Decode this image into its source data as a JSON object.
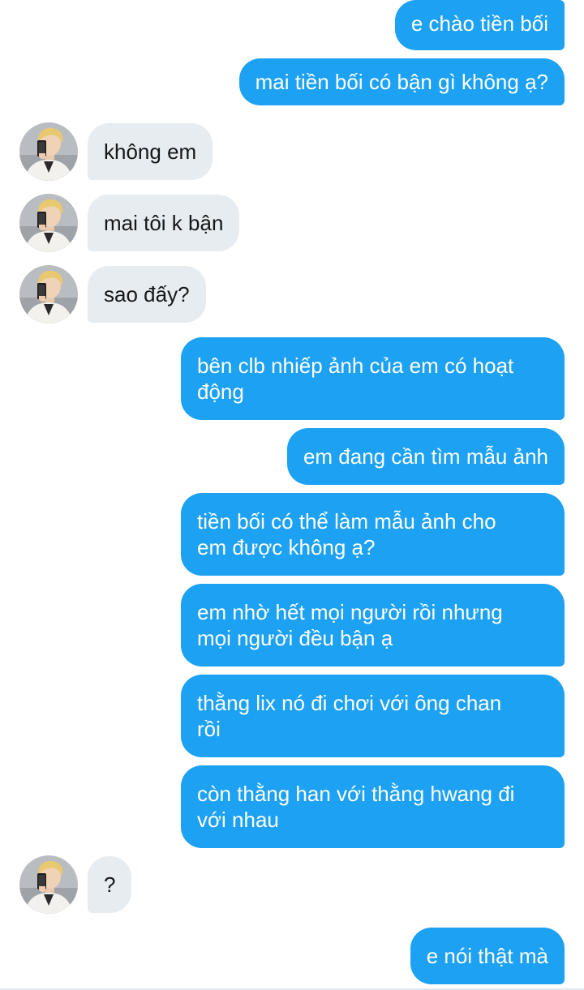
{
  "conversation": {
    "messages": [
      {
        "sender": "me",
        "text": "e chào tiền bối"
      },
      {
        "sender": "me",
        "text": "mai tiền bối có bận gì không ạ?"
      },
      {
        "sender": "them",
        "text": "không em"
      },
      {
        "sender": "them",
        "text": "mai tôi k bận"
      },
      {
        "sender": "them",
        "text": "sao đấy?"
      },
      {
        "sender": "me",
        "text": "bên clb nhiếp ảnh của em có hoạt\nđộng"
      },
      {
        "sender": "me",
        "text": "em đang cần tìm mẫu ảnh"
      },
      {
        "sender": "me",
        "text": "tiền bối có thể làm mẫu ảnh cho\nem được không ạ?"
      },
      {
        "sender": "me",
        "text": "em nhờ hết mọi người rồi nhưng\nmọi người đều bận ạ"
      },
      {
        "sender": "me",
        "text": "thằng lix nó đi chơi với ông chan\nrồi"
      },
      {
        "sender": "me",
        "text": "còn thằng han với thằng hwang đi\nvới nhau"
      },
      {
        "sender": "them",
        "text": "?"
      },
      {
        "sender": "me",
        "text": "e nói thật mà"
      }
    ]
  },
  "theme": {
    "outgoing_bubble_color": "#1da1f2",
    "incoming_bubble_color": "#e6ecf0",
    "outgoing_text_color": "#ffffff",
    "incoming_text_color": "#14171a"
  }
}
